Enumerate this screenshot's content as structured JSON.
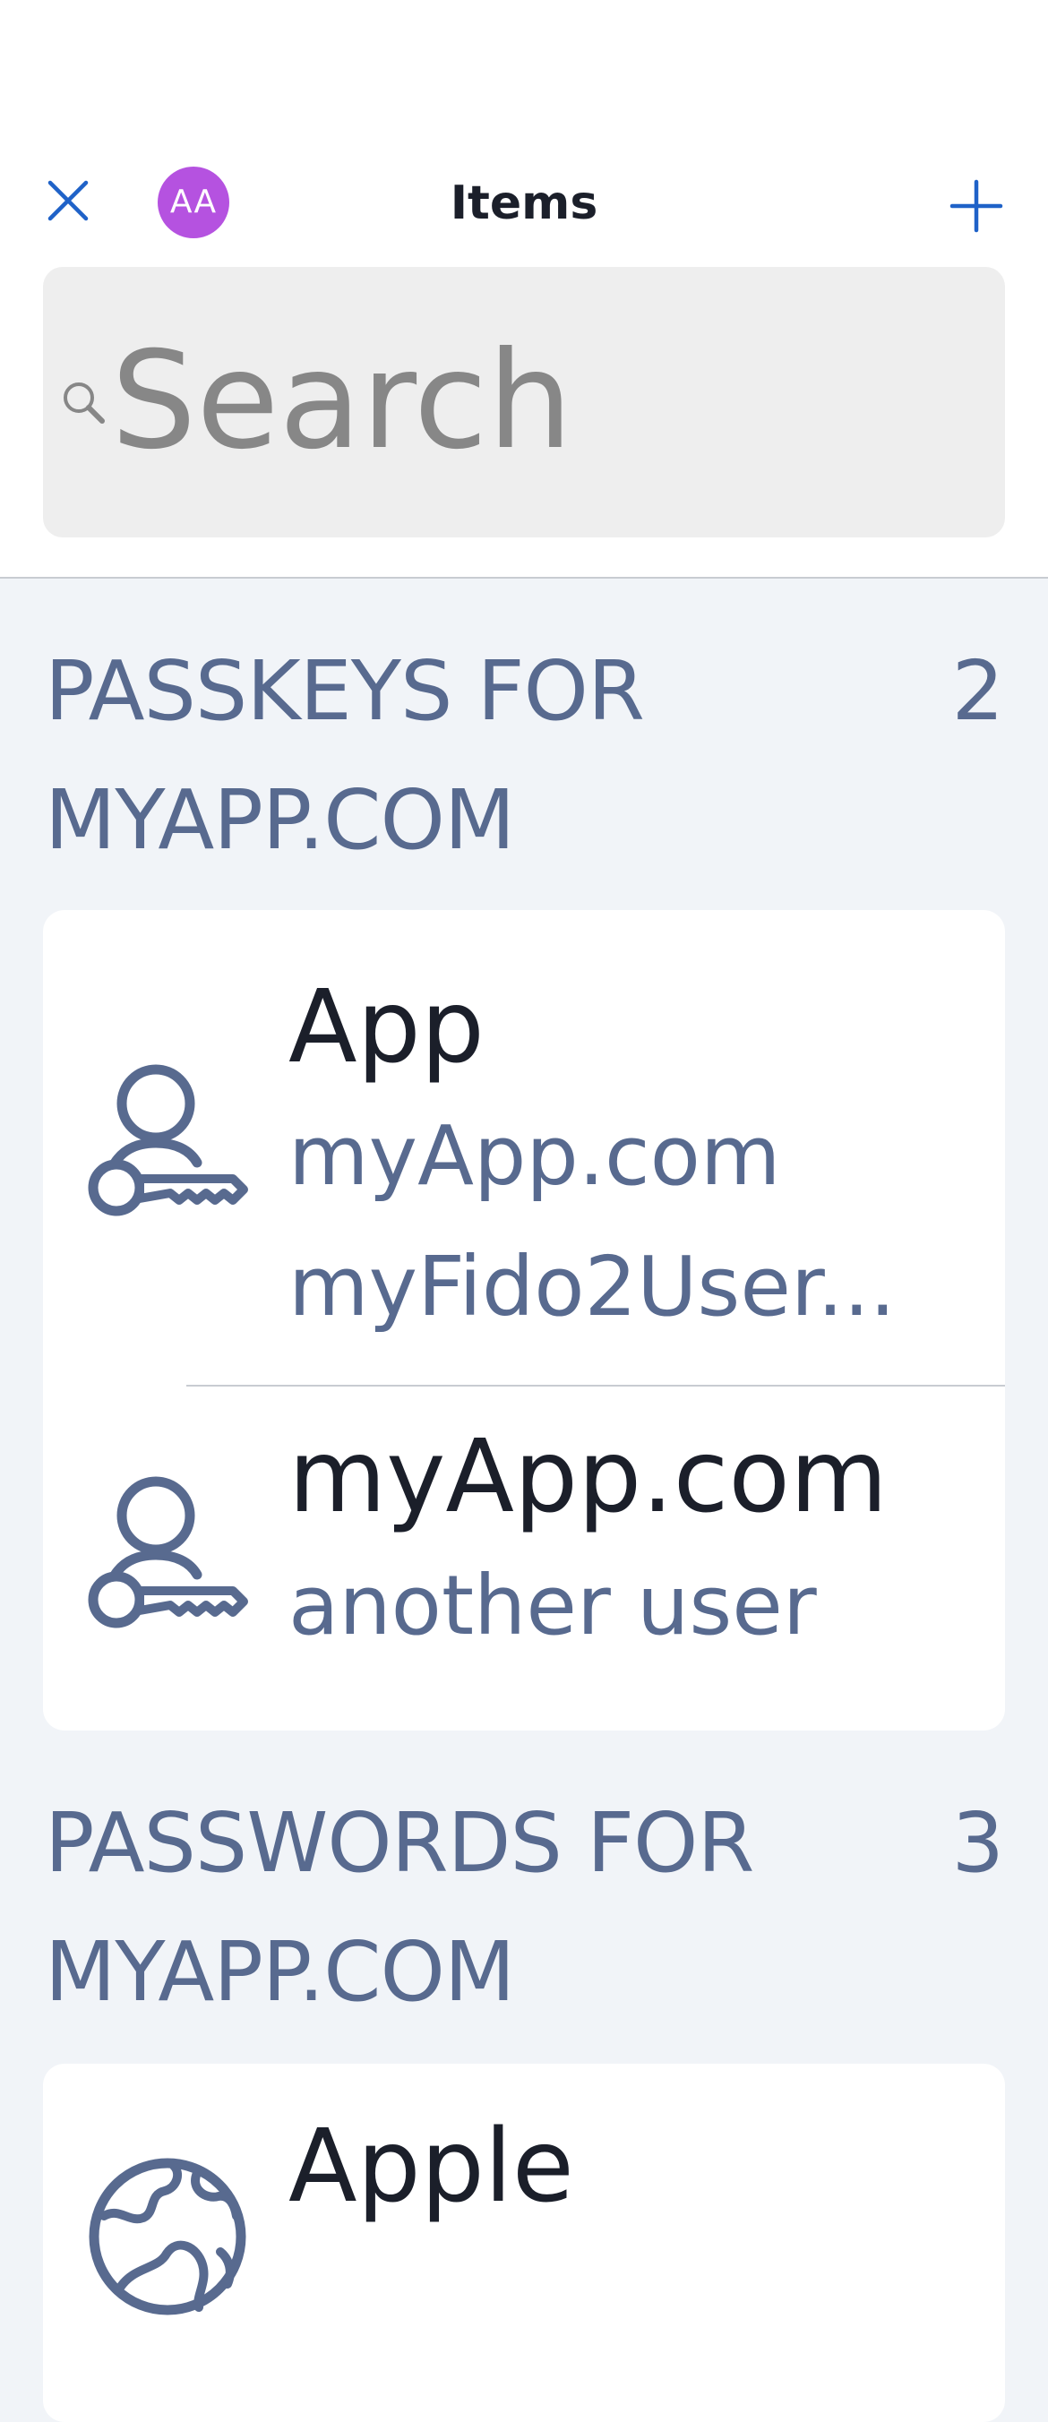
{
  "header": {
    "title": "Items",
    "avatar_initials": "AA",
    "avatar_color": "#b552e0",
    "accent_color": "#1f62c8",
    "close_icon": "close-icon",
    "add_icon": "plus-icon"
  },
  "search": {
    "placeholder": "Search",
    "value": ""
  },
  "sections": [
    {
      "title": "PASSKEYS FOR MYAPP.COM",
      "count": "2",
      "items": [
        {
          "icon": "passkey-icon",
          "title": "App",
          "subtitles": [
            "myApp.com",
            "myFido2User..."
          ]
        },
        {
          "icon": "passkey-icon",
          "title": "myApp.com",
          "subtitles": [
            "another user"
          ]
        }
      ]
    },
    {
      "title": "PASSWORDS FOR MYAPP.COM",
      "count": "3",
      "items": [
        {
          "icon": "globe-icon",
          "title": "Apple",
          "subtitles": []
        }
      ]
    }
  ]
}
